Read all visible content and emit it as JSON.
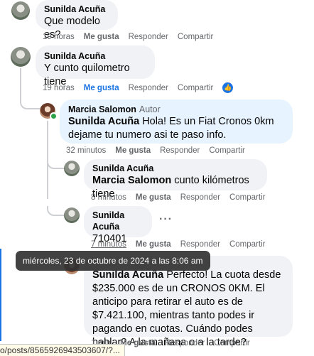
{
  "comments": [
    {
      "author": "Sunilda Acuña",
      "text": "Que modelo es?",
      "time": "19 horas",
      "like": "Me gusta",
      "reply": "Responder",
      "share": "Compartir"
    },
    {
      "author": "Sunilda Acuña",
      "text": "Y cunto quilometro tiene",
      "time": "19 horas",
      "like": "Me gusta",
      "reply": "Responder",
      "share": "Compartir",
      "reaction_icon": "thumbs-up-icon"
    }
  ],
  "replies": [
    {
      "author": "Marcia Salomon",
      "badge": "Autor",
      "mention": "Sunilda Acuña",
      "text": " Hola! Es un Fiat Cronos 0km dejame tu numero asi te paso info.",
      "time": "32 minutos",
      "like": "Me gusta",
      "reply": "Responder",
      "share": "Compartir"
    },
    {
      "author": "Sunilda Acuña",
      "mention": "Marcia Salomon",
      "text": " cunto kilómetros tiene",
      "time": "8 minutos",
      "like": "Me gusta",
      "reply": "Responder",
      "share": "Compartir"
    },
    {
      "author": "Sunilda Acuña",
      "text": "710401",
      "time": "7 minutos",
      "like": "Me gusta",
      "reply": "Responder",
      "share": "Compartir"
    },
    {
      "mention": "Sunilda Acuña",
      "text": " Perfecto! La cuota desde $235.000 es de un CRONOS 0KM. El anticipo para retirar el auto es de $7.421.100, mientras tanto podes ir pagando en cuotas. Cuándo podes hablar? A la mañana o a la tarde?",
      "time": "1 min",
      "like": "Me gusta",
      "reply": "Responder",
      "share": "Compartir"
    }
  ],
  "tooltip": "miércoles, 23 de octubre de 2024 a las 8:06 am",
  "status_url": "o/posts/8565926943503607/?...",
  "colors": {
    "accent": "#1b74e4",
    "bubble": "#f0f2f5",
    "bubble_highlight": "#e7f3ff",
    "meta_text": "#65676b"
  }
}
